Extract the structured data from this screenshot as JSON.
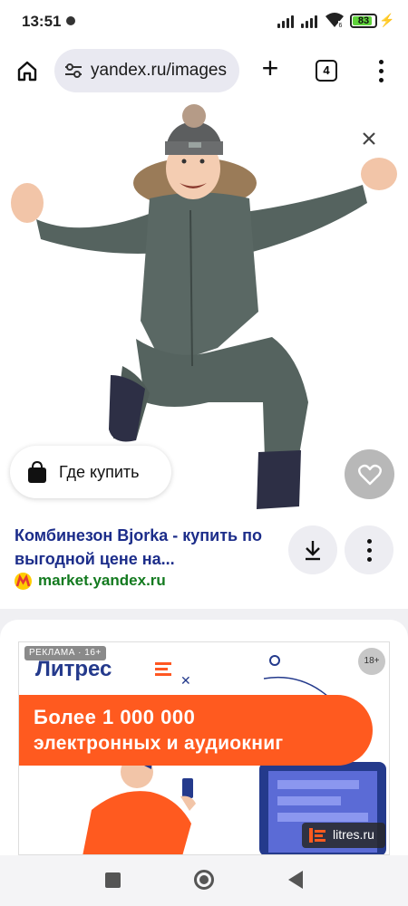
{
  "status_bar": {
    "time": "13:51",
    "battery": "83"
  },
  "browser": {
    "url": "yandex.ru/images",
    "tab_count": "4"
  },
  "result": {
    "where_to_buy": "Где купить",
    "title": "Комбинезон Bjorka - купить по выгодной цене на...",
    "source": "market.yandex.ru"
  },
  "ad": {
    "label": "РЕКЛАМА · 16+",
    "brand": "Литрес",
    "age_rating": "18+",
    "headline_1": "Более  1 000 000",
    "headline_2": "электронных и аудиокниг",
    "source": "litres.ru"
  },
  "colors": {
    "title_link": "#1c2d8a",
    "source_green": "#137a1f",
    "ad_orange": "#ff5a1f",
    "ad_brand_blue": "#243a8c"
  },
  "icons": {
    "home": "home-icon",
    "tune": "site-settings-icon",
    "plus": "plus-icon",
    "tabs": "tabs-icon",
    "menu": "more-vert-icon",
    "close": "close-icon",
    "bag": "shopping-bag-icon",
    "heart": "heart-icon",
    "download": "download-icon"
  }
}
